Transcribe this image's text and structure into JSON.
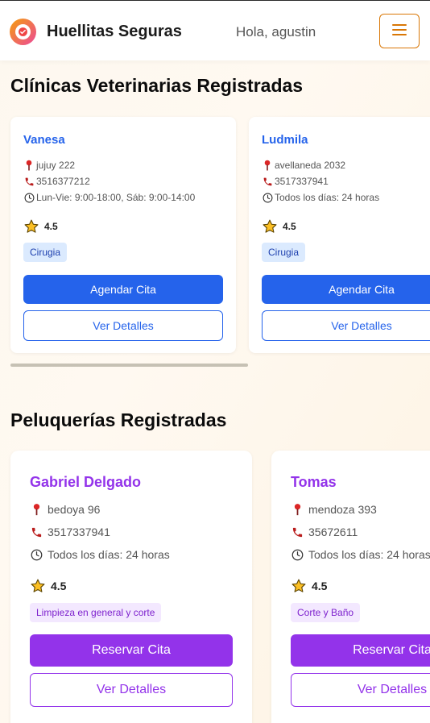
{
  "header": {
    "brand": "Huellitas Seguras",
    "greeting": "Hola, agustin",
    "menu_icon": "hamburger-icon",
    "logo_icon": "check-circle-icon",
    "accent_color": "#d97706"
  },
  "clinics": {
    "title": "Clínicas Veterinarias Registradas",
    "accent_color": "#2563eb",
    "items": [
      {
        "name": "Vanesa",
        "address": "jujuy 222",
        "phone": "3516377212",
        "hours": "Lun-Vie: 9:00-18:00, Sáb: 9:00-14:00",
        "rating": "4.5",
        "tag": "Cirugia",
        "primary_button": "Agendar Cita",
        "secondary_button": "Ver Detalles"
      },
      {
        "name": "Ludmila",
        "address": "avellaneda 2032",
        "phone": "3517337941",
        "hours": "Todos los días: 24 horas",
        "rating": "4.5",
        "tag": "Cirugia",
        "primary_button": "Agendar Cita",
        "secondary_button": "Ver Detalles"
      }
    ]
  },
  "groomers": {
    "title": "Peluquerías Registradas",
    "accent_color": "#9333ea",
    "items": [
      {
        "name": "Gabriel Delgado",
        "address": "bedoya 96",
        "phone": "3517337941",
        "hours": "Todos los días: 24 horas",
        "rating": "4.5",
        "tag": "Limpieza en general y corte",
        "primary_button": "Reservar Cita",
        "secondary_button": "Ver Detalles"
      },
      {
        "name": "Tomas",
        "address": "mendoza 393",
        "phone": "35672611",
        "hours": "Todos los días: 24 horas",
        "rating": "4.5",
        "tag": "Corte y Baño",
        "primary_button": "Reservar Cita",
        "secondary_button": "Ver Detalles"
      }
    ]
  },
  "icons": {
    "address": "map-pin-icon",
    "phone": "phone-icon",
    "hours": "clock-icon",
    "rating": "star-icon"
  }
}
